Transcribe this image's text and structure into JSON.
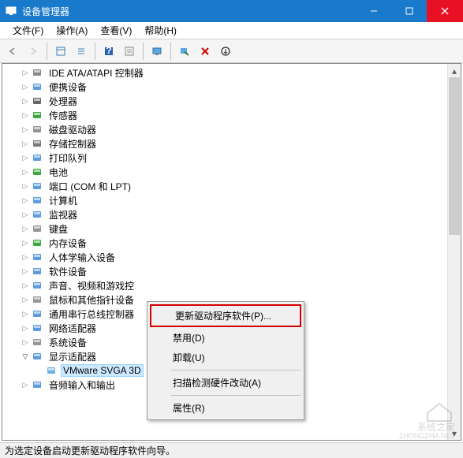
{
  "window": {
    "title": "设备管理器"
  },
  "menu": {
    "file": "文件(F)",
    "action": "操作(A)",
    "view": "查看(V)",
    "help": "帮助(H)"
  },
  "tree": {
    "items": [
      {
        "label": "IDE ATA/ATAPI 控制器",
        "expander": "▷"
      },
      {
        "label": "便携设备",
        "expander": "▷"
      },
      {
        "label": "处理器",
        "expander": "▷"
      },
      {
        "label": "传感器",
        "expander": "▷"
      },
      {
        "label": "磁盘驱动器",
        "expander": "▷"
      },
      {
        "label": "存储控制器",
        "expander": "▷"
      },
      {
        "label": "打印队列",
        "expander": "▷"
      },
      {
        "label": "电池",
        "expander": "▷"
      },
      {
        "label": "端口 (COM 和 LPT)",
        "expander": "▷"
      },
      {
        "label": "计算机",
        "expander": "▷"
      },
      {
        "label": "监视器",
        "expander": "▷"
      },
      {
        "label": "键盘",
        "expander": "▷"
      },
      {
        "label": "内存设备",
        "expander": "▷"
      },
      {
        "label": "人体学输入设备",
        "expander": "▷"
      },
      {
        "label": "软件设备",
        "expander": "▷"
      },
      {
        "label": "声音、视频和游戏控",
        "expander": "▷"
      },
      {
        "label": "鼠标和其他指针设备",
        "expander": "▷"
      },
      {
        "label": "通用串行总线控制器",
        "expander": "▷"
      },
      {
        "label": "网络适配器",
        "expander": "▷"
      },
      {
        "label": "系统设备",
        "expander": "▷"
      },
      {
        "label": "显示适配器",
        "expander": "▽",
        "expanded": true
      },
      {
        "label": "VMware SVGA 3D",
        "child": true,
        "selected": true,
        "expander": ""
      },
      {
        "label": "音频输入和输出",
        "expander": "▷"
      }
    ]
  },
  "context_menu": {
    "update_driver": "更新驱动程序软件(P)...",
    "disable": "禁用(D)",
    "uninstall": "卸载(U)",
    "scan": "扫描检测硬件改动(A)",
    "properties": "属性(R)"
  },
  "status": {
    "text": "为选定设备启动更新驱动程序软件向导。"
  },
  "watermark": {
    "line1": "系统之家",
    "line2": "ZHONGZHA.NET"
  }
}
